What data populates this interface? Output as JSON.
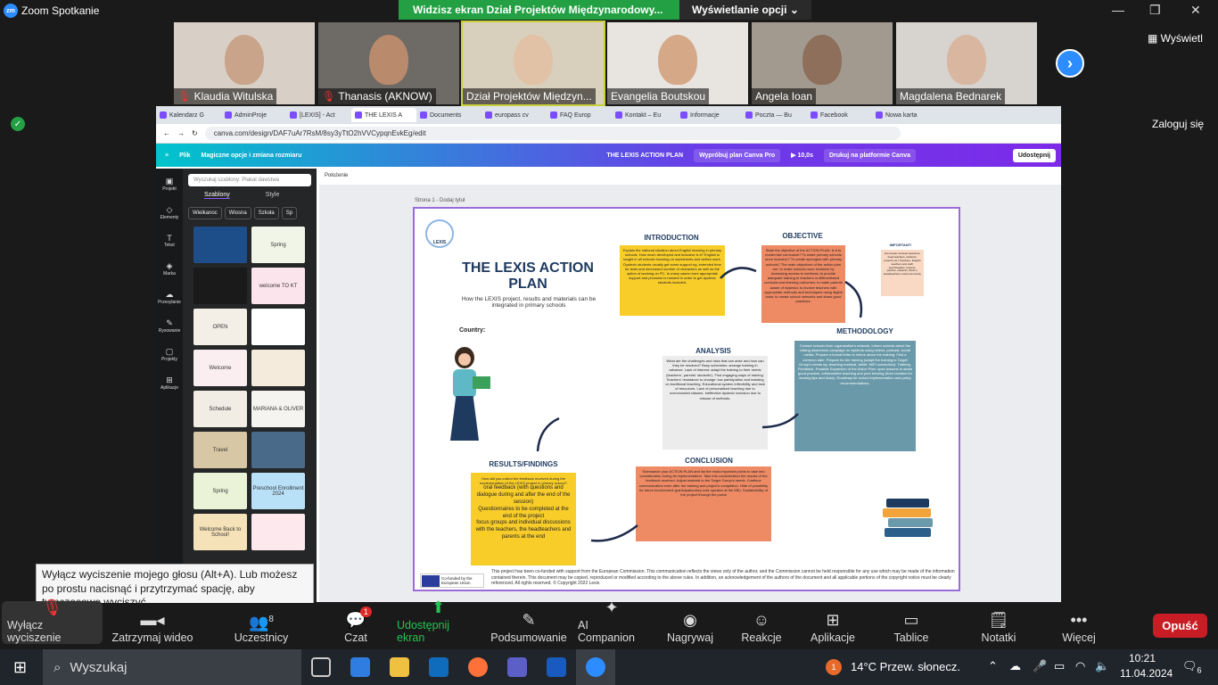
{
  "window": {
    "title": "Zoom Spotkanie",
    "logo": "zm"
  },
  "share_banner": {
    "text": "Widzisz ekran Dział Projektów Międzynarodowy...",
    "options": "Wyświetlanie opcji"
  },
  "participants": [
    {
      "name": "Klaudia Witulska",
      "muted": true,
      "bg": "#d8d0c6",
      "face": "#caa48a"
    },
    {
      "name": "Thanasis (AKNOW)",
      "muted": true,
      "bg": "#6e6a66",
      "face": "#b98a6c"
    },
    {
      "name": "Dział Projektów Międzyn...",
      "muted": false,
      "bg": "#d9cfbd",
      "face": "#e2c2a6"
    },
    {
      "name": "Evangelia Boutskou",
      "muted": false,
      "bg": "#e8e4e0",
      "face": "#d5a887"
    },
    {
      "name": "Angela Ioan",
      "muted": false,
      "bg": "#a39a8f",
      "face": "#8d6f5c"
    },
    {
      "name": "Magdalena Bednarek",
      "muted": false,
      "bg": "#d7d3cf",
      "face": "#d9b6a0"
    }
  ],
  "side": {
    "view": "Wyświetl",
    "login": "Zaloguj się"
  },
  "browser": {
    "tabs": [
      "Kalendarz G",
      "AdminProje",
      "[LEXIS] - Act",
      "THE LEXIS A",
      "Documents",
      "europass cv",
      "FAQ Europ",
      "Kontakt – Eu",
      "Informacje",
      "Poczta — Bu",
      "Facebook",
      "Nowa karta"
    ],
    "url": "canva.com/design/DAF7uAr7RsM/8sy3yTtO2hVVCypqnEvkEg/edit"
  },
  "canva": {
    "menu": [
      "Plik",
      "Magiczne opcje i zmiana rozmiaru"
    ],
    "doc_title": "THE LEXIS ACTION PLAN",
    "try_pro": "Wypróbuj plan Canva Pro",
    "timer": "10,0s",
    "print": "Drukuj na platformie Canva",
    "share": "Udostępnij",
    "rail": [
      "Projekt",
      "Elementy",
      "Tekst",
      "Marka",
      "Przesyłanie",
      "Rysowanie",
      "Projekty",
      "Aplikacje"
    ],
    "search_placeholder": "Wyszukaj szablony: Plakat dawstwa",
    "panel_tabs": [
      "Szablony",
      "Style"
    ],
    "chips": [
      "Wielkanoc",
      "Wiosna",
      "Szkoła",
      "Sp"
    ],
    "thumbs": [
      {
        "t": "",
        "bg": "#1d4e8a"
      },
      {
        "t": "Spring",
        "bg": "#f0f5e8"
      },
      {
        "t": "",
        "bg": "#1a1a1a"
      },
      {
        "t": "welcome TO KT",
        "bg": "#fce4ec"
      },
      {
        "t": "OPEN",
        "bg": "#f4efe6"
      },
      {
        "t": "",
        "bg": "#ffffff"
      },
      {
        "t": "Welcome",
        "bg": "#fbeef0"
      },
      {
        "t": "",
        "bg": "#f4ebdc"
      },
      {
        "t": "Schedule",
        "bg": "#f1ece4"
      },
      {
        "t": "MARIANA & OLIVER",
        "bg": "#f6f4f0"
      },
      {
        "t": "Travel",
        "bg": "#d8c7a4"
      },
      {
        "t": "",
        "bg": "#4a6a8a"
      },
      {
        "t": "Spring",
        "bg": "#eaf3d8"
      },
      {
        "t": "Preschool Enrollment 2024",
        "bg": "#b8e0f6"
      },
      {
        "t": "Welcome Back to School!",
        "bg": "#f6e2b8"
      },
      {
        "t": "",
        "bg": "#fde8ee"
      }
    ],
    "subbar": "Położenie",
    "page_label": "Strona 1 - Dodaj tytuł"
  },
  "design": {
    "logo": "LEXIS",
    "title": "THE LEXIS ACTION PLAN",
    "subtitle": "How the LEXIS project, results and materials can be integrated in primary schools",
    "country": "Country:",
    "intro_h": "INTRODUCTION",
    "intro": "Explain the national situation about English learning in primary schools. How much developed and inclusive is it? English is taught in all schools focusing on worksheets and written work. Dyslexic students usually get some support eg. extended time for tests and decreased number of characters as well as the option of working on PC. In many cases more appropriate support and provision is needed in order to get dyslexic students included.",
    "obj_h": "OBJECTIVE",
    "obj": "State the objective of the ACTION PLAN. Is it to modernise curriculum? To make primary schools more inclusive? To create synergies with primary schools? The main objectives of the action plan are: to make schools more inclusive by increasing access to methods; to provide adequate training to teachers in differentiated curricula and learning outcomes; to make parents aware of dyslexia; to involve teachers with appropriate methods and techniques using digital tools; to create school networks and share good practices.",
    "important_h": "IMPORTANT!",
    "important": "List people involved (teachers, head teachers, students, parents etc.) Teachers, English teachers and staff, psychologists, trainers, parents, students, NGO-s, Headteachers, local community",
    "method_h": "METHODOLOGY",
    "method": "Contact schools from organisation's network. Inform schools about the raising awareness campaign on dyslexia using videos, podcast, social media. Prepare a formal letter to inform about the training. Find a common date. Prepare for the training (adapt the training to Target Group's needs eg. teaching material, tablet, WiFi connection). Training. Feedback. Possible Expansion of the Action Plan: open lessons to share good practice, collaborative teaching and peer tutoring (from creation for sharing tips and tricks). Roadmap for school implementation and policy recommendations.",
    "analysis_h": "ANALYSIS",
    "analysis": "What are the challenges and risks that can arise and how can they be resolved? Busy schedules: arrange training in advance. Lack of interest: adapt the training to their needs (teachers', parents' students'). Find engaging ways of training. Teachers' resistance to change: low participation and insisting on traditional teaching. Educational system inflexibility and lack of resources. Lack of personalised teaching due to overcrowded classes. Ineffective dyslexic inclusion due to misuse of methods.",
    "conc_h": "CONCLUSION",
    "conc": "Summarize your ACTION PLAN and list the most important points to take into consideration during its implementation. Take into consideration the results of the feedback received. Adjust material to the Target Group's needs. Continue communication even after the training and project's completion. Hide of possibility for future involvement (participation/key note speaker at the ME). Sustainability of the project through the portal",
    "results_h": "RESULTS/FINDINGS",
    "results_q": "How will you collect the feedback received during the implementation of the LEXIS project in primary school?",
    "results": [
      "oral feedback (with questions and dialogue during and after the end of the session)",
      "Questionnaires to be completed at the end of the project",
      "focus groups and individual discussions with the teachers, the headteachers and parents at the end"
    ],
    "eu_text": "Co-funded by the European Union",
    "footer": "This project has been co-funded with support from the European Commission. This communication reflects the views only of the author, and the Commission cannot be held responsible for any use which may be made of the information contained therein. This document may be copied, reproduced or modified according to the above rules. In addition, an acknowledgement of the authors of the document and all applicable portions of the copyright notice must be clearly referenced. All rights reserved. © Copyright 2022 Lexis"
  },
  "tooltip": "Wyłącz wyciszenie mojego głosu (Alt+A). Lub możesz po prostu nacisnąć i przytrzymać spację, aby tymczasowo wyciszyć.",
  "toolbar": {
    "unmute": "Wyłącz wyciszenie",
    "video": "Zatrzymaj wideo",
    "participants": "Uczestnicy",
    "participants_count": "8",
    "chat": "Czat",
    "chat_badge": "1",
    "share": "Udostępnij ekran",
    "summary": "Podsumowanie",
    "ai": "AI Companion",
    "record": "Nagrywaj",
    "reactions": "Reakcje",
    "apps": "Aplikacje",
    "whiteboards": "Tablice",
    "notes": "Notatki",
    "more": "Więcej",
    "leave": "Opuść"
  },
  "taskbar": {
    "search": "Wyszukaj",
    "weather": "14°C  Przew. słonecz.",
    "time": "10:21",
    "date": "11.04.2024",
    "notif": "6",
    "weather_badge": "1"
  }
}
